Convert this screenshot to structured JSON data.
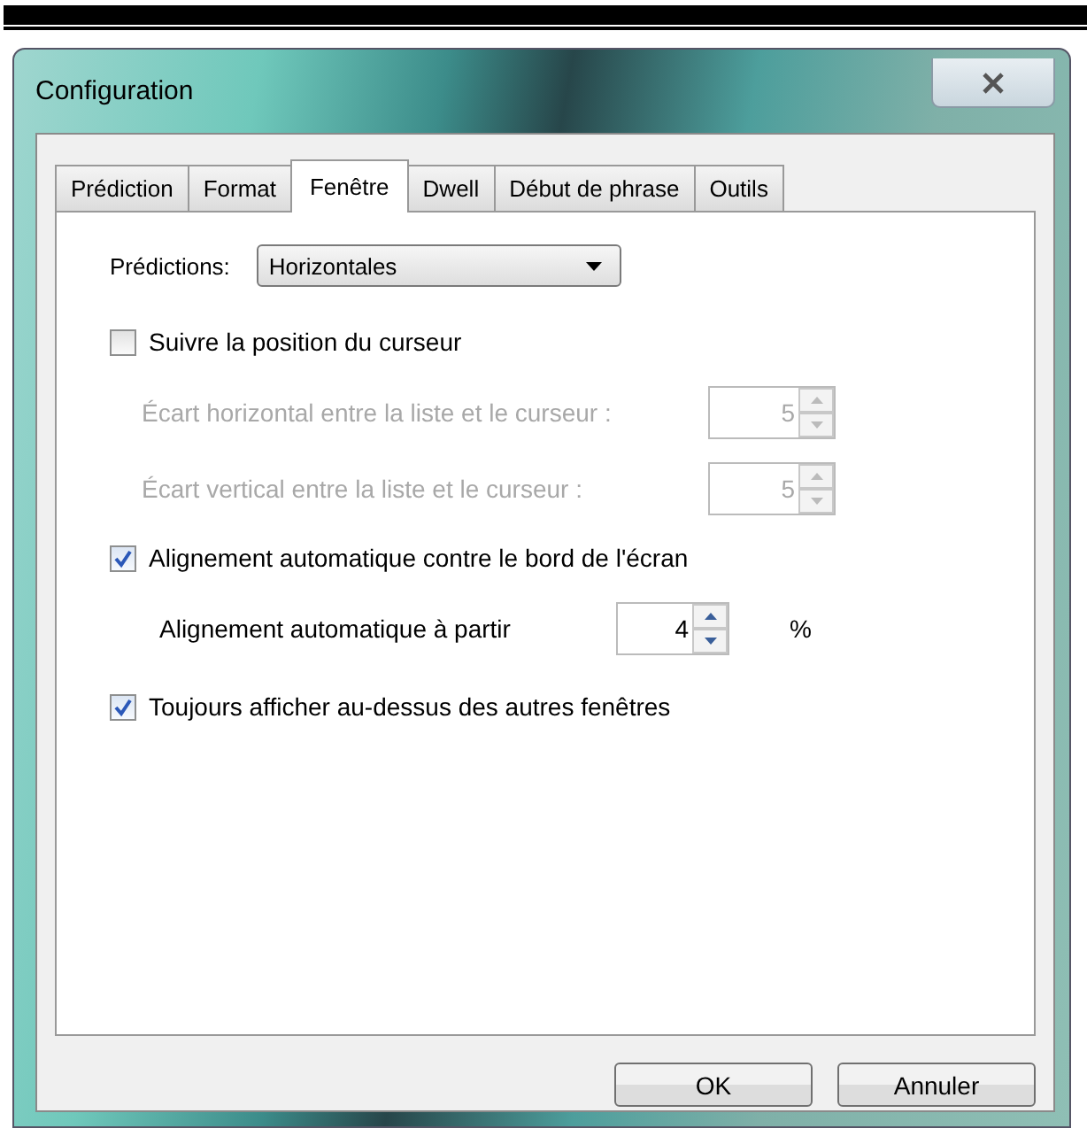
{
  "window": {
    "title": "Configuration"
  },
  "tabs": [
    {
      "label": "Prédiction",
      "selected": false
    },
    {
      "label": "Format",
      "selected": false
    },
    {
      "label": "Fenêtre",
      "selected": true
    },
    {
      "label": "Dwell",
      "selected": false
    },
    {
      "label": "Début de phrase",
      "selected": false
    },
    {
      "label": "Outils",
      "selected": false
    }
  ],
  "predictions": {
    "label": "Prédictions:",
    "value": "Horizontales"
  },
  "options": [
    {
      "kind": "checkbox",
      "label": "Suivre la position du curseur",
      "checked": false
    },
    {
      "kind": "spinner",
      "label": "Écart horizontal entre la liste et le curseur :",
      "value": "5",
      "disabled": true
    },
    {
      "kind": "spinner",
      "label": "Écart vertical entre la liste et le curseur :",
      "value": "5",
      "disabled": true
    },
    {
      "kind": "checkbox",
      "label": "Alignement automatique contre le bord de l'écran",
      "checked": true
    },
    {
      "kind": "spinner",
      "label": "Alignement automatique à partir",
      "value": "4",
      "disabled": false,
      "unit": "%"
    },
    {
      "kind": "checkbox",
      "label": "Toujours afficher au-dessus des autres fenêtres",
      "checked": true
    }
  ],
  "buttons": [
    "OK",
    "Annuler"
  ]
}
